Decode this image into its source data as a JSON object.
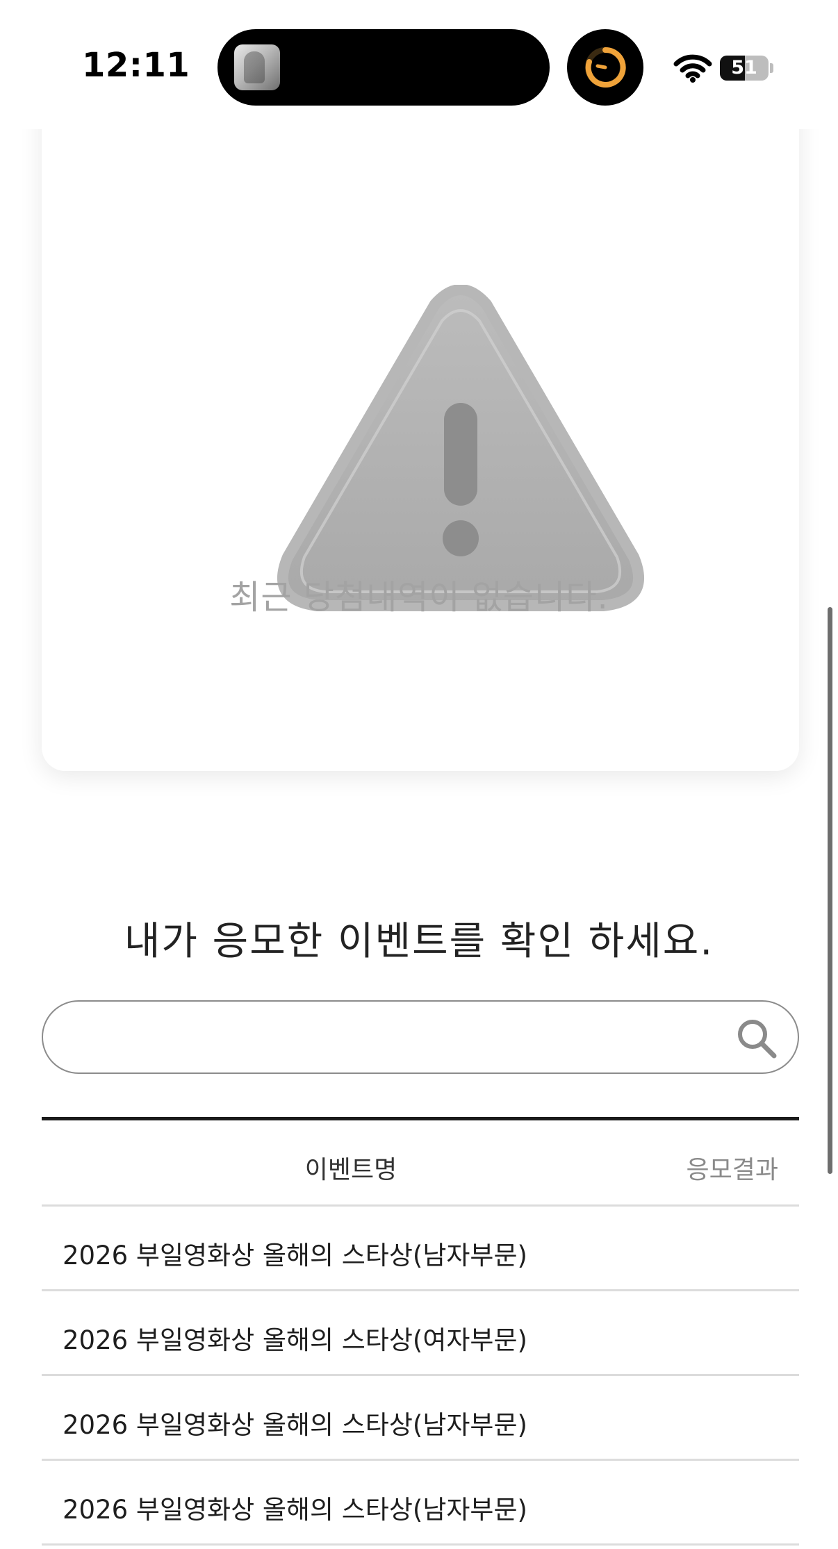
{
  "status_bar": {
    "time": "12:11",
    "battery_percent": "51",
    "battery_level": 0.51,
    "icons": [
      "now-playing-thumbnail",
      "timer-icon",
      "wifi-icon",
      "battery-icon"
    ]
  },
  "empty_state": {
    "icon": "warning-icon",
    "message": "최근 당첨내역이 없습니다."
  },
  "events": {
    "title": "내가 응모한 이벤트를 확인 하세요.",
    "search": {
      "value": "",
      "placeholder": "",
      "icon": "search-icon"
    },
    "columns": {
      "name": "이벤트명",
      "result": "응모결과"
    },
    "rows": [
      {
        "title": "2026 부일영화상 올해의 스타상(남자부문)",
        "result": ""
      },
      {
        "title": "2026 부일영화상 올해의 스타상(여자부문)",
        "result": ""
      },
      {
        "title": "2026 부일영화상 올해의 스타상(남자부문)",
        "result": ""
      },
      {
        "title": "2026 부일영화상 올해의 스타상(남자부문)",
        "result": ""
      }
    ]
  },
  "colors": {
    "accent_timer": "#f0a33a",
    "muted_text": "#a3a3a3",
    "divider": "#dcdcdc",
    "rule": "#1b1b1b"
  }
}
